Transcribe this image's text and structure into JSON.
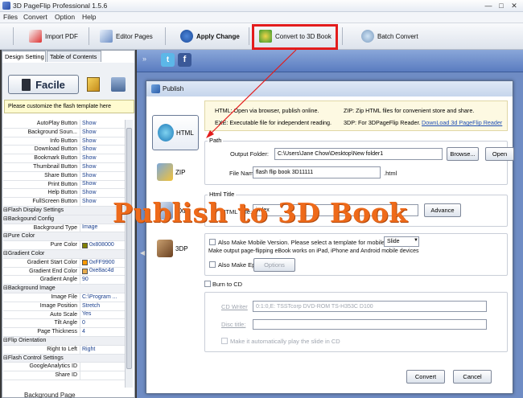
{
  "window": {
    "title": "3D PageFlip Professional 1.5.6",
    "min": "—",
    "max": "□",
    "close": "✕"
  },
  "menu": [
    "Files",
    "Convert",
    "Option",
    "Help"
  ],
  "toolbar": {
    "import_pdf": "Import PDF",
    "editor_pages": "Editor Pages",
    "apply_change": "Apply Change",
    "convert_3d": "Convert to 3D Book",
    "batch_convert": "Batch Convert"
  },
  "left": {
    "tabs": [
      "Design Setting",
      "Table of Contents"
    ],
    "facile": "Facile",
    "hint": "Please customize the flash template here",
    "bottom": "Background Page",
    "properties": [
      {
        "k": "AutoPlay Button",
        "v": "Show"
      },
      {
        "k": "Background Soun...",
        "v": "Show"
      },
      {
        "k": "Info Button",
        "v": "Show"
      },
      {
        "k": "Download Button",
        "v": "Show"
      },
      {
        "k": "Bookmark Button",
        "v": "Show"
      },
      {
        "k": "Thumbnail Button",
        "v": "Show"
      },
      {
        "k": "Share Button",
        "v": "Show"
      },
      {
        "k": "Print Button",
        "v": "Show"
      },
      {
        "k": "Help Button",
        "v": "Show"
      },
      {
        "k": "FullScreen Button",
        "v": "Show"
      },
      {
        "k": "⊟Flash Display Settings",
        "group": true
      },
      {
        "k": "⊟Backgound Config",
        "group": true
      },
      {
        "k": "Background Type",
        "v": "Image"
      },
      {
        "k": "⊟Pure Color",
        "group": true
      },
      {
        "k": "Pure Color",
        "v": "0x808000",
        "color": "#808000"
      },
      {
        "k": "⊟Gradient Color",
        "group": true
      },
      {
        "k": "Gradient Start Color",
        "v": "0xFF9900",
        "color": "#FF9900"
      },
      {
        "k": "Gradient End Color",
        "v": "0xe8ac4d",
        "color": "#e8ac4d"
      },
      {
        "k": "Gradient Angle",
        "v": "90"
      },
      {
        "k": "⊟Background Image",
        "group": true
      },
      {
        "k": "Image File",
        "v": "C:\\Program ..."
      },
      {
        "k": "Image Position",
        "v": "Stretch"
      },
      {
        "k": "Auto Scale",
        "v": "Yes"
      },
      {
        "k": "Tilt Angle",
        "v": "0"
      },
      {
        "k": "Page Thickness",
        "v": "4"
      },
      {
        "k": "⊟Flip Orientation",
        "group": true
      },
      {
        "k": "Right to Left",
        "v": "Right"
      },
      {
        "k": "⊟Flash Control Settings",
        "group": true
      },
      {
        "k": "GoogleAnalytics ID",
        "v": ""
      },
      {
        "k": "Share ID",
        "v": ""
      }
    ]
  },
  "social": {
    "twitter": "t",
    "facebook": "f"
  },
  "dialog": {
    "title": "Publish",
    "formats": [
      "HTML",
      "ZIP",
      "EXE",
      "3DP"
    ],
    "info": {
      "html": "HTML: Open via browser, publish online.",
      "zip": "ZIP: Zip HTML files for convenient store and share.",
      "exe": "EXE: Executable file for independent reading.",
      "3dp": "3DP: For 3DPageFlip Reader.",
      "download": "DownLoad 3d PageFlip Reader"
    },
    "path": {
      "legend": "Path",
      "output_label": "Output Folder:",
      "output_value": "C:\\Users\\Jane Chow\\Desktop\\New folder1",
      "browse": "Browse...",
      "open": "Open",
      "file_label": "File Name:",
      "file_value": "flash flip book 3D11111",
      "file_ext": ".html"
    },
    "html_title": {
      "legend": "Html Title",
      "label": "HTML Title:",
      "value": "index",
      "advance": "Advance"
    },
    "mobile": {
      "label": "Also Make Mobile Version. Please select a template for mobile:",
      "select": "Slide",
      "note": "Make output page-flipping eBook works on iPad, iPhone and Android mobile devices",
      "epub": "Also Make Epub",
      "options": "Options"
    },
    "cd": {
      "burn": "Burn to CD",
      "writer_label": "CD Writer",
      "writer_value": "0:1:0,E: TSSTcorp DVD-ROM TS-H353C D100",
      "disc_label": "Disc title:",
      "disc_value": "",
      "autoplay": "Make it automatically play the  slide in CD"
    },
    "convert": "Convert",
    "cancel": "Cancel"
  },
  "overlay": {
    "title": "Publish to 3D Book",
    "title_color": "#ee6a1a",
    "highlight_color": "#e31c1c"
  }
}
